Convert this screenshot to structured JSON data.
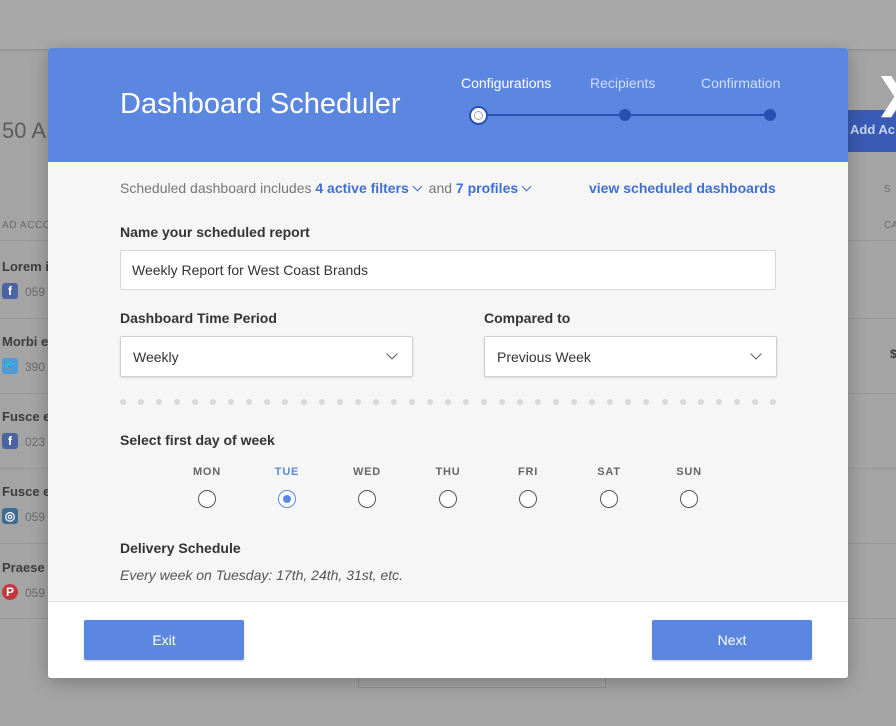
{
  "background": {
    "count_text": "50 A",
    "column_header": "AD ACCO",
    "add_button_label": "Add Ac",
    "close_glyph": "❯",
    "right_labels": [
      "S",
      "CA",
      "$"
    ],
    "rows": [
      {
        "title": "Lorem i",
        "id": "059",
        "network": "facebook",
        "icon_glyph": "f",
        "color": "#4b63a0"
      },
      {
        "title": "Morbi e",
        "id": "390",
        "network": "twitter",
        "icon_glyph": "🐦",
        "color": "#4b9cd8"
      },
      {
        "title": "Fusce e",
        "id": "023",
        "network": "facebook",
        "icon_glyph": "f",
        "color": "#4b63a0"
      },
      {
        "title": "Fusce e",
        "id": "059",
        "network": "instagram",
        "icon_glyph": "◎",
        "color": "#3e6c90"
      },
      {
        "title": "Praese",
        "id": "059",
        "network": "pinterest",
        "icon_glyph": "P",
        "color": "#c2373b"
      }
    ]
  },
  "modal": {
    "title": "Dashboard Scheduler",
    "steps": [
      {
        "label": "Configurations",
        "active": true
      },
      {
        "label": "Recipients",
        "active": false
      },
      {
        "label": "Confirmation",
        "active": false
      }
    ],
    "summary": {
      "prefix": "Scheduled dashboard includes",
      "filters_link": "4 active filters",
      "conjunction": "and",
      "profiles_link": "7 profiles"
    },
    "view_link": "view scheduled dashboards",
    "name_label": "Name your scheduled report",
    "name_value": "Weekly Report for West Coast Brands",
    "time_period_label": "Dashboard Time Period",
    "time_period_value": "Weekly",
    "compared_label": "Compared to",
    "compared_value": "Previous Week",
    "first_day_label": "Select first day of week",
    "days": [
      "MON",
      "TUE",
      "WED",
      "THU",
      "FRI",
      "SAT",
      "SUN"
    ],
    "selected_day": "TUE",
    "delivery_label": "Delivery Schedule",
    "delivery_text": "Every week on Tuesday: 17th, 24th, 31st, etc.",
    "exit_label": "Exit",
    "next_label": "Next"
  },
  "colors": {
    "header_blue": "#5c87e0",
    "step_dark": "#2a4fb3",
    "link_blue": "#3f6fd4",
    "button_blue": "#5c87e0"
  }
}
